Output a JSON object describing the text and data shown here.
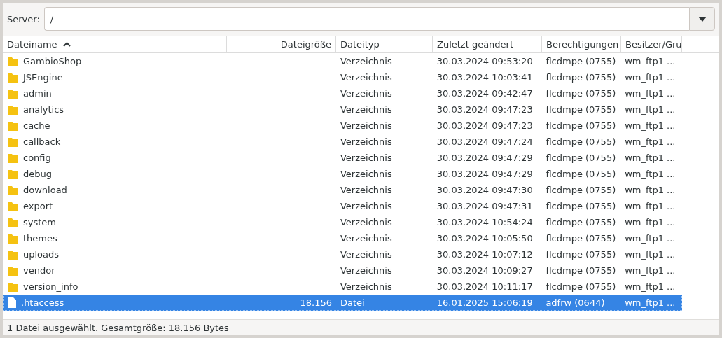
{
  "server": {
    "label": "Server:",
    "value": "/"
  },
  "columns": [
    {
      "label": "Dateiname",
      "sorted": true
    },
    {
      "label": "Dateigröße",
      "sorted": false
    },
    {
      "label": "Dateityp",
      "sorted": false
    },
    {
      "label": "Zuletzt geändert",
      "sorted": false
    },
    {
      "label": "Berechtigungen",
      "sorted": false
    },
    {
      "label": "Besitzer/Gru",
      "sorted": false
    }
  ],
  "rows": [
    {
      "kind": "folder",
      "selected": false,
      "cells": [
        "GambioShop",
        "",
        "Verzeichnis",
        "30.03.2024 09:53:20",
        "flcdmpe (0755)",
        "wm_ftp1 ..."
      ]
    },
    {
      "kind": "folder",
      "selected": false,
      "cells": [
        "JSEngine",
        "",
        "Verzeichnis",
        "30.03.2024 10:03:41",
        "flcdmpe (0755)",
        "wm_ftp1 ..."
      ]
    },
    {
      "kind": "folder",
      "selected": false,
      "cells": [
        "admin",
        "",
        "Verzeichnis",
        "30.03.2024 09:42:47",
        "flcdmpe (0755)",
        "wm_ftp1 ..."
      ]
    },
    {
      "kind": "folder",
      "selected": false,
      "cells": [
        "analytics",
        "",
        "Verzeichnis",
        "30.03.2024 09:47:23",
        "flcdmpe (0755)",
        "wm_ftp1 ..."
      ]
    },
    {
      "kind": "folder",
      "selected": false,
      "cells": [
        "cache",
        "",
        "Verzeichnis",
        "30.03.2024 09:47:23",
        "flcdmpe (0755)",
        "wm_ftp1 ..."
      ]
    },
    {
      "kind": "folder",
      "selected": false,
      "cells": [
        "callback",
        "",
        "Verzeichnis",
        "30.03.2024 09:47:24",
        "flcdmpe (0755)",
        "wm_ftp1 ..."
      ]
    },
    {
      "kind": "folder",
      "selected": false,
      "cells": [
        "config",
        "",
        "Verzeichnis",
        "30.03.2024 09:47:29",
        "flcdmpe (0755)",
        "wm_ftp1 ..."
      ]
    },
    {
      "kind": "folder",
      "selected": false,
      "cells": [
        "debug",
        "",
        "Verzeichnis",
        "30.03.2024 09:47:29",
        "flcdmpe (0755)",
        "wm_ftp1 ..."
      ]
    },
    {
      "kind": "folder",
      "selected": false,
      "cells": [
        "download",
        "",
        "Verzeichnis",
        "30.03.2024 09:47:30",
        "flcdmpe (0755)",
        "wm_ftp1 ..."
      ]
    },
    {
      "kind": "folder",
      "selected": false,
      "cells": [
        "export",
        "",
        "Verzeichnis",
        "30.03.2024 09:47:31",
        "flcdmpe (0755)",
        "wm_ftp1 ..."
      ]
    },
    {
      "kind": "folder",
      "selected": false,
      "cells": [
        "system",
        "",
        "Verzeichnis",
        "30.03.2024 10:54:24",
        "flcdmpe (0755)",
        "wm_ftp1 ..."
      ]
    },
    {
      "kind": "folder",
      "selected": false,
      "cells": [
        "themes",
        "",
        "Verzeichnis",
        "30.03.2024 10:05:50",
        "flcdmpe (0755)",
        "wm_ftp1 ..."
      ]
    },
    {
      "kind": "folder",
      "selected": false,
      "cells": [
        "uploads",
        "",
        "Verzeichnis",
        "30.03.2024 10:07:12",
        "flcdmpe (0755)",
        "wm_ftp1 ..."
      ]
    },
    {
      "kind": "folder",
      "selected": false,
      "cells": [
        "vendor",
        "",
        "Verzeichnis",
        "30.03.2024 10:09:27",
        "flcdmpe (0755)",
        "wm_ftp1 ..."
      ]
    },
    {
      "kind": "folder",
      "selected": false,
      "cells": [
        "version_info",
        "",
        "Verzeichnis",
        "30.03.2024 10:11:17",
        "flcdmpe (0755)",
        "wm_ftp1 ..."
      ]
    },
    {
      "kind": "file",
      "selected": true,
      "cells": [
        ".htaccess",
        "18.156",
        "Datei",
        "16.01.2025 15:06:19",
        "adfrw (0644)",
        "wm_ftp1 ..."
      ]
    }
  ],
  "status_bar": "1 Datei ausgewählt. Gesamtgröße: 18.156 Bytes"
}
